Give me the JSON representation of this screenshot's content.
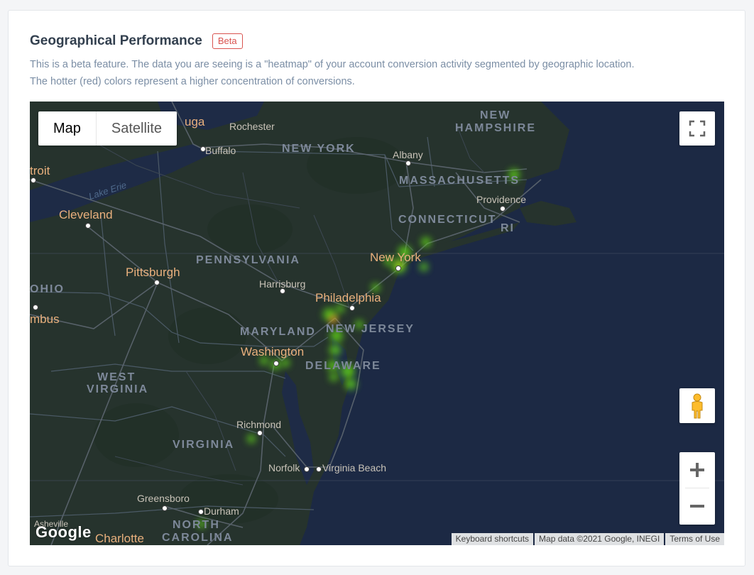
{
  "header": {
    "title": "Geographical Performance",
    "badge": "Beta",
    "description_line1": "This is a beta feature. The data you are seeing is a \"heatmap\" of your account conversion activity segmented by geographic location.",
    "description_line2": "The hotter (red) colors represent a higher concentration of conversions."
  },
  "map": {
    "type_control": {
      "map_label": "Map",
      "satellite_label": "Satellite",
      "selected": "Map"
    },
    "labels": {
      "cayuga": "uga",
      "rochester": "Rochester",
      "buffalo": "Buffalo",
      "new_york_state": "NEW YORK",
      "albany": "Albany",
      "new_hampshire_1": "NEW",
      "new_hampshire_2": "HAMPSHIRE",
      "massachusetts": "MASSACHUSETTS",
      "providence": "Providence",
      "connecticut": "CONNECTICUT",
      "ri": "RI",
      "detroit": "troit",
      "lake_erie": "Lake Erie",
      "cleveland": "Cleveland",
      "pennsylvania": "PENNSYLVANIA",
      "new_york_city": "New York",
      "pittsburgh": "Pittsburgh",
      "harrisburg": "Harrisburg",
      "philadelphia": "Philadelphia",
      "ohio": "OHIO",
      "columbus": "mbus",
      "maryland": "MARYLAND",
      "new_jersey": "NEW JERSEY",
      "washington": "Washington",
      "delaware": "DELAWARE",
      "west_virginia_1": "WEST",
      "west_virginia_2": "VIRGINIA",
      "richmond": "Richmond",
      "virginia": "VIRGINIA",
      "norfolk": "Norfolk",
      "virginia_beach": "Virginia Beach",
      "greensboro": "Greensboro",
      "durham": "Durham",
      "asheville": "Asheville",
      "charlotte": "Charlotte",
      "north_carolina_1": "NORTH",
      "north_carolina_2": "CAROLINA"
    },
    "google_logo": "Google",
    "attribution": {
      "keyboard_shortcuts": "Keyboard shortcuts",
      "map_data": "Map data ©2021 Google, INEGI",
      "terms": "Terms of Use"
    },
    "icons": {
      "fullscreen": "fullscreen-icon",
      "pegman": "pegman-icon",
      "zoom_in": "plus-icon",
      "zoom_out": "minus-icon"
    },
    "colors": {
      "background": "#1c2944",
      "land": "#2b3a2e",
      "heat_low": "#5fd11a",
      "heat_high": "#e53e1e"
    }
  }
}
